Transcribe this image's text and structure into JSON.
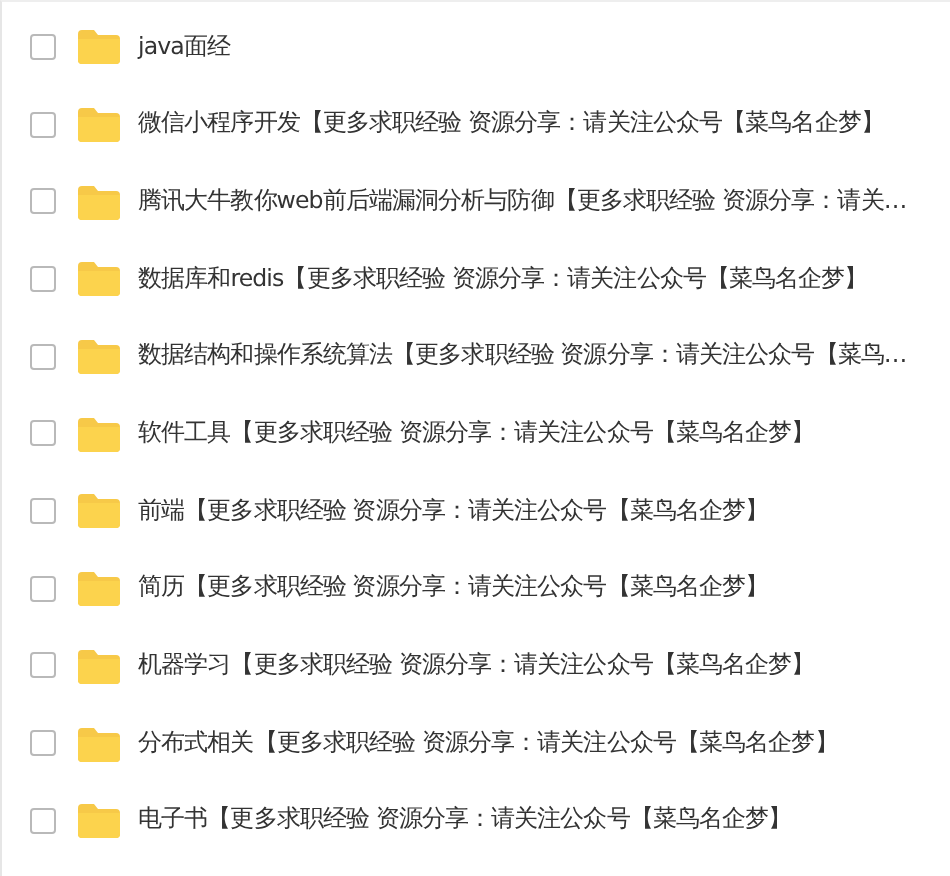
{
  "files": [
    {
      "name": "java面经",
      "checked": false
    },
    {
      "name": "微信小程序开发【更多求职经验 资源分享：请关注公众号【菜鸟名企梦】",
      "checked": false
    },
    {
      "name": "腾讯大牛教你web前后端漏洞分析与防御【更多求职经验 资源分享：请关…",
      "checked": false
    },
    {
      "name": "数据库和redis【更多求职经验 资源分享：请关注公众号【菜鸟名企梦】",
      "checked": false
    },
    {
      "name": "数据结构和操作系统算法【更多求职经验 资源分享：请关注公众号【菜鸟…",
      "checked": false
    },
    {
      "name": "软件工具【更多求职经验 资源分享：请关注公众号【菜鸟名企梦】",
      "checked": false
    },
    {
      "name": "前端【更多求职经验 资源分享：请关注公众号【菜鸟名企梦】",
      "checked": false
    },
    {
      "name": "简历【更多求职经验 资源分享：请关注公众号【菜鸟名企梦】",
      "checked": false
    },
    {
      "name": "机器学习【更多求职经验 资源分享：请关注公众号【菜鸟名企梦】",
      "checked": false
    },
    {
      "name": "分布式相关【更多求职经验 资源分享：请关注公众号【菜鸟名企梦】",
      "checked": false
    },
    {
      "name": "电子书【更多求职经验 资源分享：请关注公众号【菜鸟名企梦】",
      "checked": false
    }
  ]
}
